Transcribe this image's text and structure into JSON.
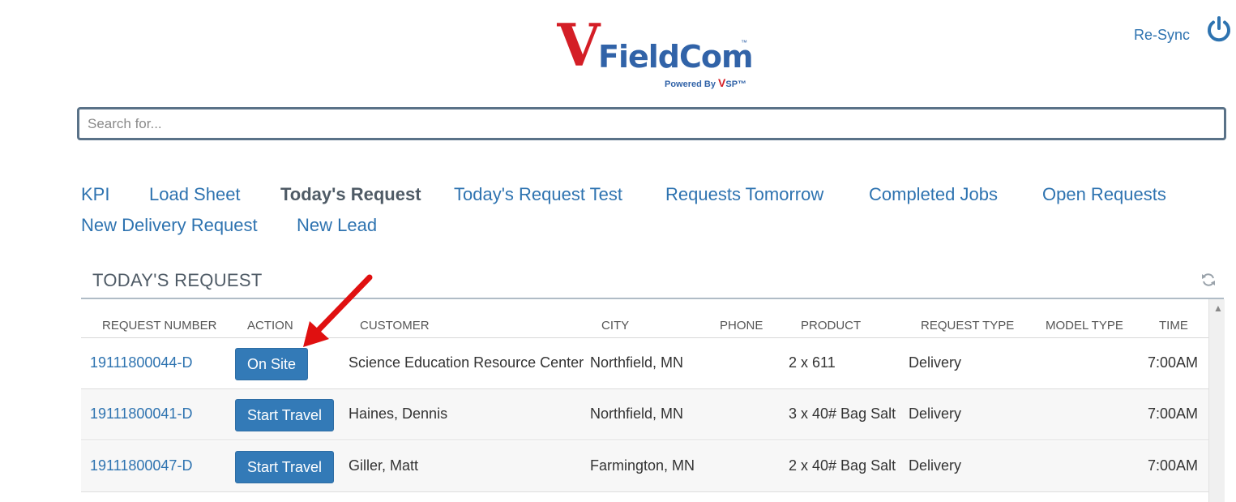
{
  "brand": {
    "letter": "V",
    "name": "FieldCom",
    "tm": "™",
    "powered_prefix": "Powered By ",
    "powered_v": "V",
    "powered_suffix": "SP™"
  },
  "header": {
    "resync_label": "Re-Sync",
    "power_icon": "power-icon"
  },
  "search": {
    "placeholder": "Search for..."
  },
  "nav": [
    {
      "label": "KPI",
      "active": false
    },
    {
      "label": "Load Sheet",
      "active": false
    },
    {
      "label": "Today's Request",
      "active": true
    },
    {
      "label": "Today's Request Test",
      "active": false
    },
    {
      "label": "Requests Tomorrow",
      "active": false
    },
    {
      "label": "Completed Jobs",
      "active": false
    },
    {
      "label": "Open Requests",
      "active": false
    },
    {
      "label": "New Delivery Request",
      "active": false
    },
    {
      "label": "New Lead",
      "active": false
    }
  ],
  "section": {
    "title": "TODAY'S REQUEST",
    "refresh_icon": "refresh-icon"
  },
  "table": {
    "columns": [
      "REQUEST NUMBER",
      "ACTION",
      "CUSTOMER",
      "CITY",
      "PHONE",
      "PRODUCT",
      "REQUEST TYPE",
      "MODEL TYPE",
      "TIME"
    ],
    "rows": [
      {
        "request_number": "19111800044-D",
        "action": "On Site",
        "customer": "Science Education Resource Center",
        "city": "Northfield, MN",
        "phone": "",
        "product": "2 x 611",
        "request_type": "Delivery",
        "model_type": "",
        "time": "7:00AM"
      },
      {
        "request_number": "19111800041-D",
        "action": "Start Travel",
        "customer": "Haines, Dennis",
        "city": "Northfield, MN",
        "phone": "",
        "product": "3 x 40# Bag Salt",
        "request_type": "Delivery",
        "model_type": "",
        "time": "7:00AM"
      },
      {
        "request_number": "19111800047-D",
        "action": "Start Travel",
        "customer": "Giller, Matt",
        "city": "Farmington, MN",
        "phone": "",
        "product": "2 x 40# Bag Salt",
        "request_type": "Delivery",
        "model_type": "",
        "time": "7:00AM"
      }
    ]
  },
  "colors": {
    "link": "#2e73b0",
    "button": "#337ab7",
    "brand_red": "#d41e26",
    "brand_blue": "#3163a8",
    "annotation_arrow": "#e01010"
  }
}
